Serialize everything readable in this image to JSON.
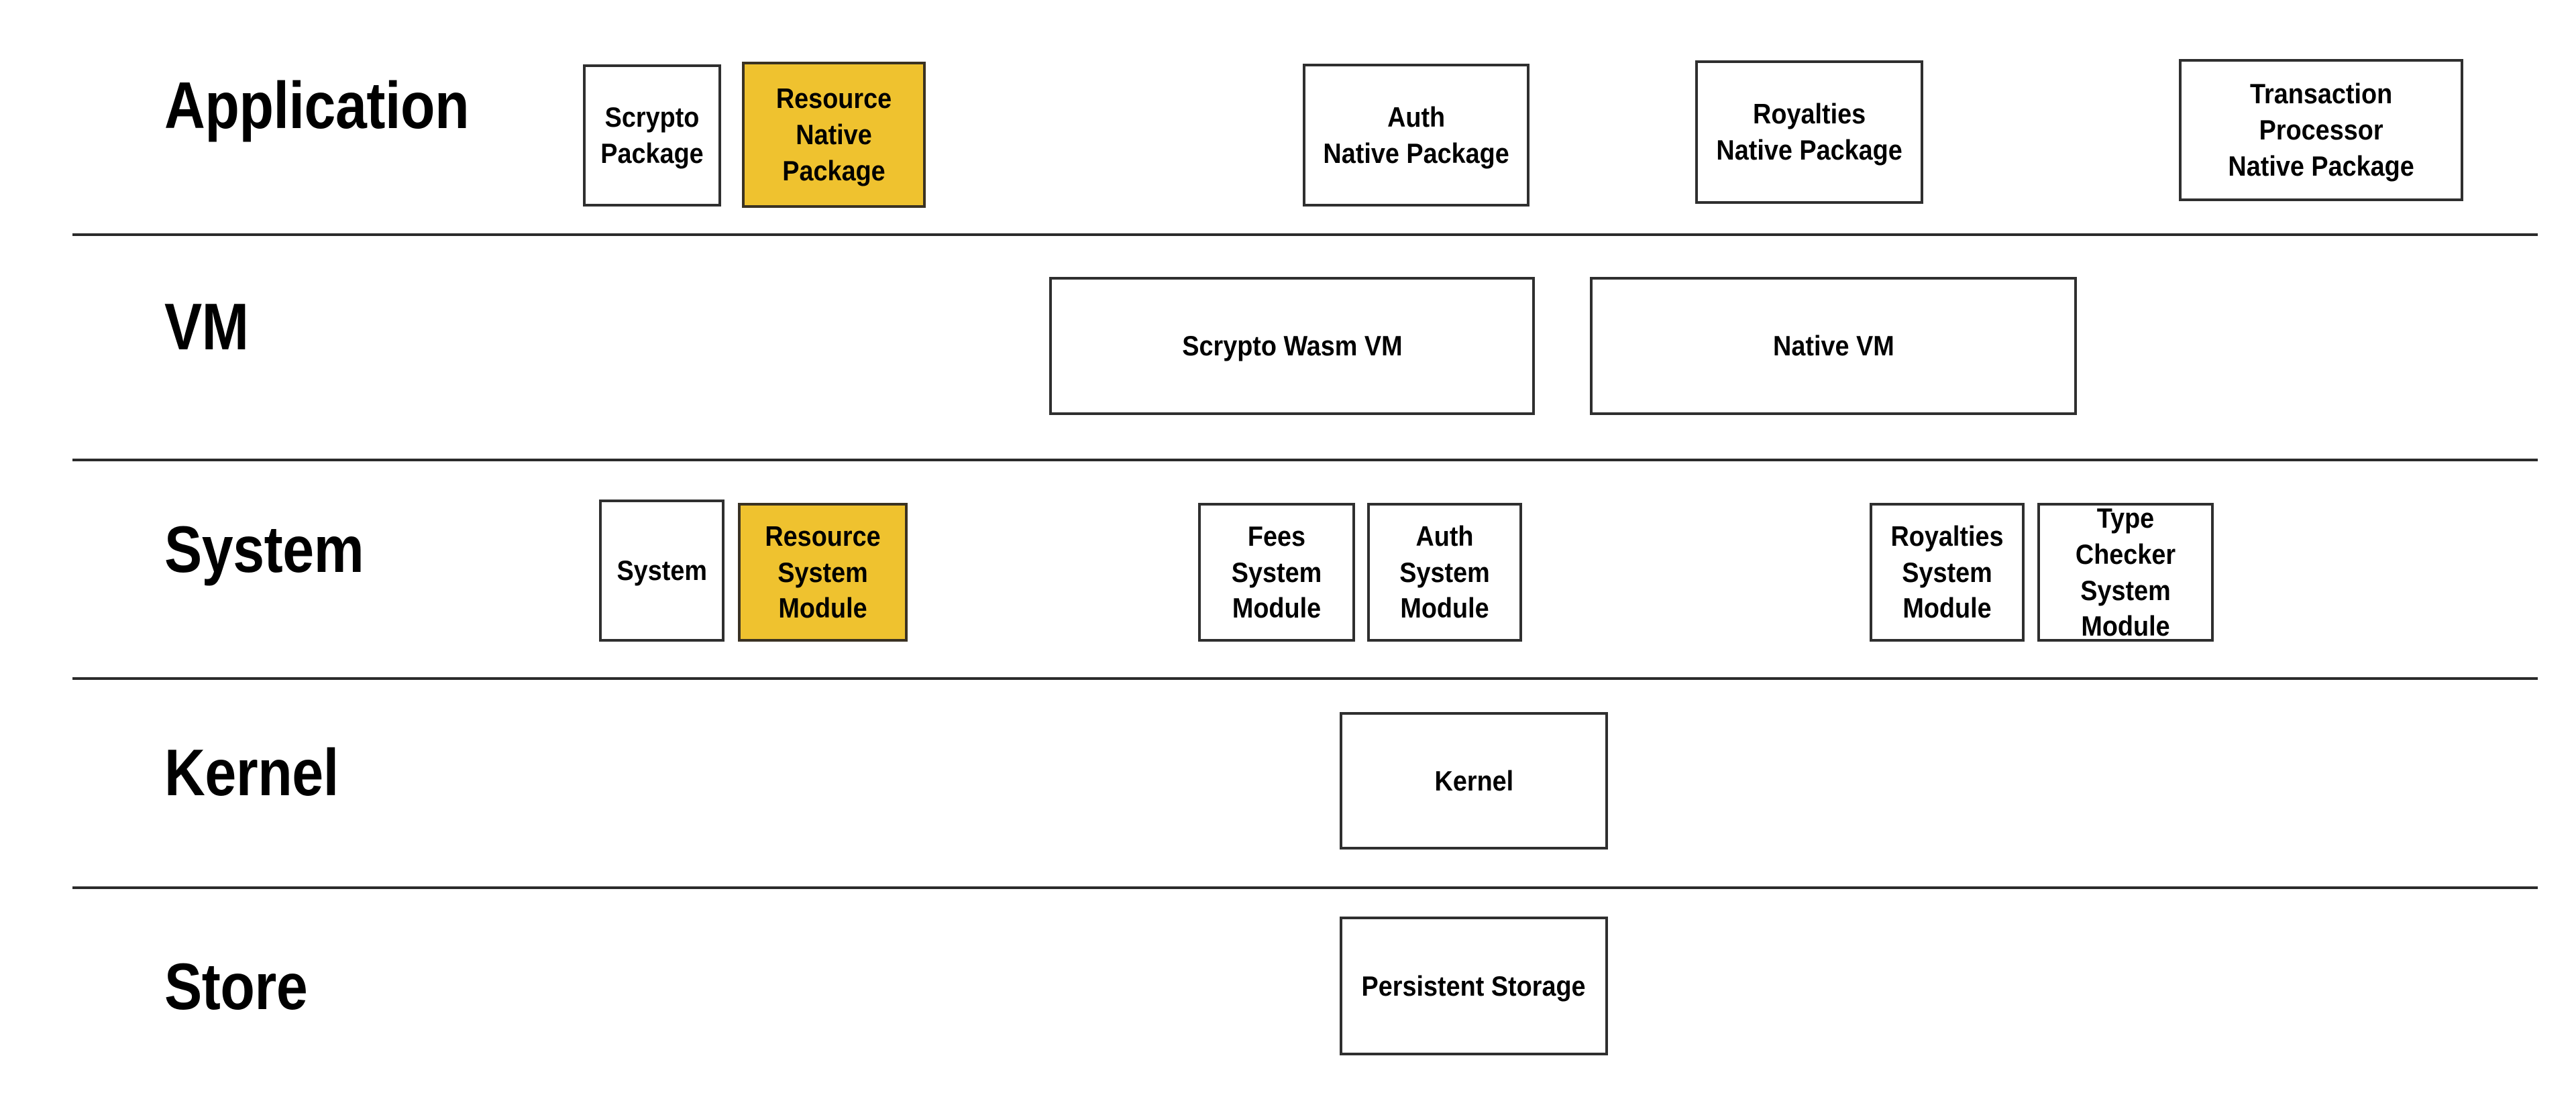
{
  "diagram": {
    "title": "Radix Engine layered architecture stack",
    "accent_color": "#efc22f",
    "line_color": "#2b2b2b",
    "background": "#ffffff"
  },
  "layers": [
    {
      "id": "application",
      "label": "Application"
    },
    {
      "id": "vm",
      "label": "VM"
    },
    {
      "id": "system",
      "label": "System"
    },
    {
      "id": "kernel",
      "label": "Kernel"
    },
    {
      "id": "store",
      "label": "Store"
    }
  ],
  "nodes": {
    "application": [
      {
        "id": "scrypto-package",
        "label": "Scrypto Package",
        "highlighted": false
      },
      {
        "id": "resource-native-package",
        "label": "Resource\nNative Package",
        "highlighted": true
      },
      {
        "id": "auth-native-package",
        "label": "Auth\nNative Package",
        "highlighted": false
      },
      {
        "id": "royalties-native-package",
        "label": "Royalties\nNative Package",
        "highlighted": false
      },
      {
        "id": "transaction-processor-native-package",
        "label": "Transaction\nProcessor\nNative Package",
        "highlighted": false
      }
    ],
    "vm": [
      {
        "id": "scrypto-wasm-vm",
        "label": "Scrypto Wasm VM",
        "highlighted": false
      },
      {
        "id": "native-vm",
        "label": "Native VM",
        "highlighted": false
      }
    ],
    "system": [
      {
        "id": "system",
        "label": "System",
        "highlighted": false
      },
      {
        "id": "resource-system-module",
        "label": "Resource\nSystem Module",
        "highlighted": true
      },
      {
        "id": "fees-system-module",
        "label": "Fees\nSystem Module",
        "highlighted": false
      },
      {
        "id": "auth-system-module",
        "label": "Auth\nSystem Module",
        "highlighted": false
      },
      {
        "id": "royalties-system-module",
        "label": "Royalties\nSystem Module",
        "highlighted": false
      },
      {
        "id": "type-checker-system-module",
        "label": "Type Checker\nSystem Module",
        "highlighted": false
      }
    ],
    "kernel": [
      {
        "id": "kernel",
        "label": "Kernel",
        "highlighted": false
      }
    ],
    "store": [
      {
        "id": "persistent-storage",
        "label": "Persistent Storage",
        "highlighted": false
      }
    ]
  }
}
